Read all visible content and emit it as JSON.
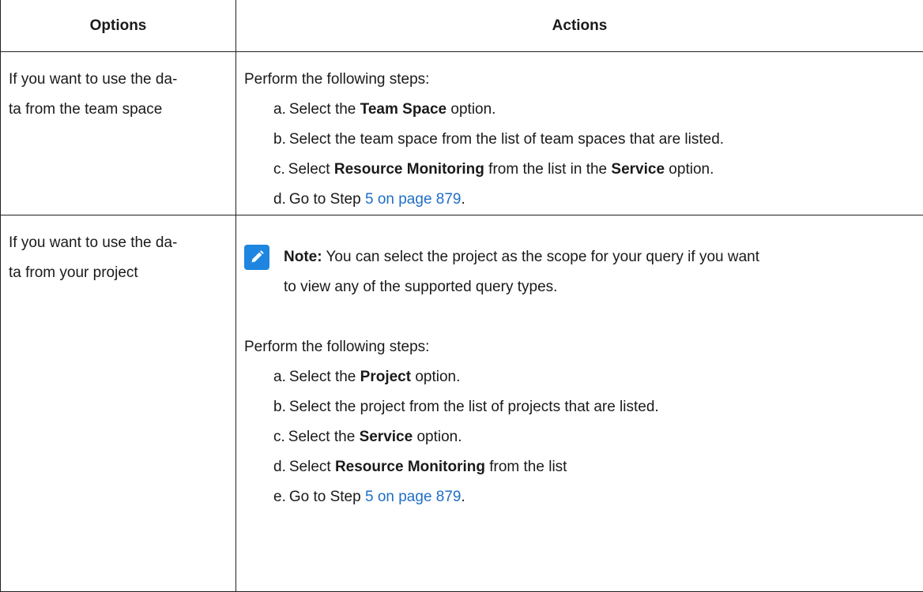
{
  "table": {
    "headers": {
      "options": "Options",
      "actions": "Actions"
    },
    "rows": [
      {
        "option_line1": "If you want to use the da-",
        "option_line2": "ta from the team space",
        "intro": "Perform the following steps:",
        "steps": [
          {
            "marker": "a.",
            "pre": "Select the ",
            "bold": "Team Space",
            "post": " option."
          },
          {
            "marker": "b.",
            "text": "Select the team space from the list of team spaces that are listed."
          },
          {
            "marker": "c.",
            "pre": "Select ",
            "bold1": "Resource Monitoring",
            "mid": " from the list in the ",
            "bold2": "Service",
            "post": " option."
          },
          {
            "marker": "d.",
            "pre": "Go to Step ",
            "link": "5 on page 879",
            "post": "."
          }
        ]
      },
      {
        "option_line1": "If you want to use the da-",
        "option_line2": "ta from your project",
        "note_label": "Note:",
        "note_line1": " You can select the project as the scope for your query if you want",
        "note_line2": "to view any of the supported query types.",
        "intro": "Perform the following steps:",
        "steps": [
          {
            "marker": "a.",
            "pre": "Select the ",
            "bold": "Project",
            "post": " option."
          },
          {
            "marker": "b.",
            "text": "Select the project from the list of projects that are listed."
          },
          {
            "marker": "c.",
            "pre": "Select the ",
            "bold": "Service",
            "post": " option."
          },
          {
            "marker": "d.",
            "pre": "Select ",
            "bold": "Resource Monitoring",
            "post": " from the list"
          },
          {
            "marker": "e.",
            "pre": "Go to Step ",
            "link": "5 on page 879",
            "post": "."
          }
        ]
      }
    ]
  },
  "colors": {
    "link": "#1f6fc6",
    "note_icon": "#1e86e0",
    "border": "#222222"
  },
  "icons": {
    "note": "pencil-note-icon"
  }
}
